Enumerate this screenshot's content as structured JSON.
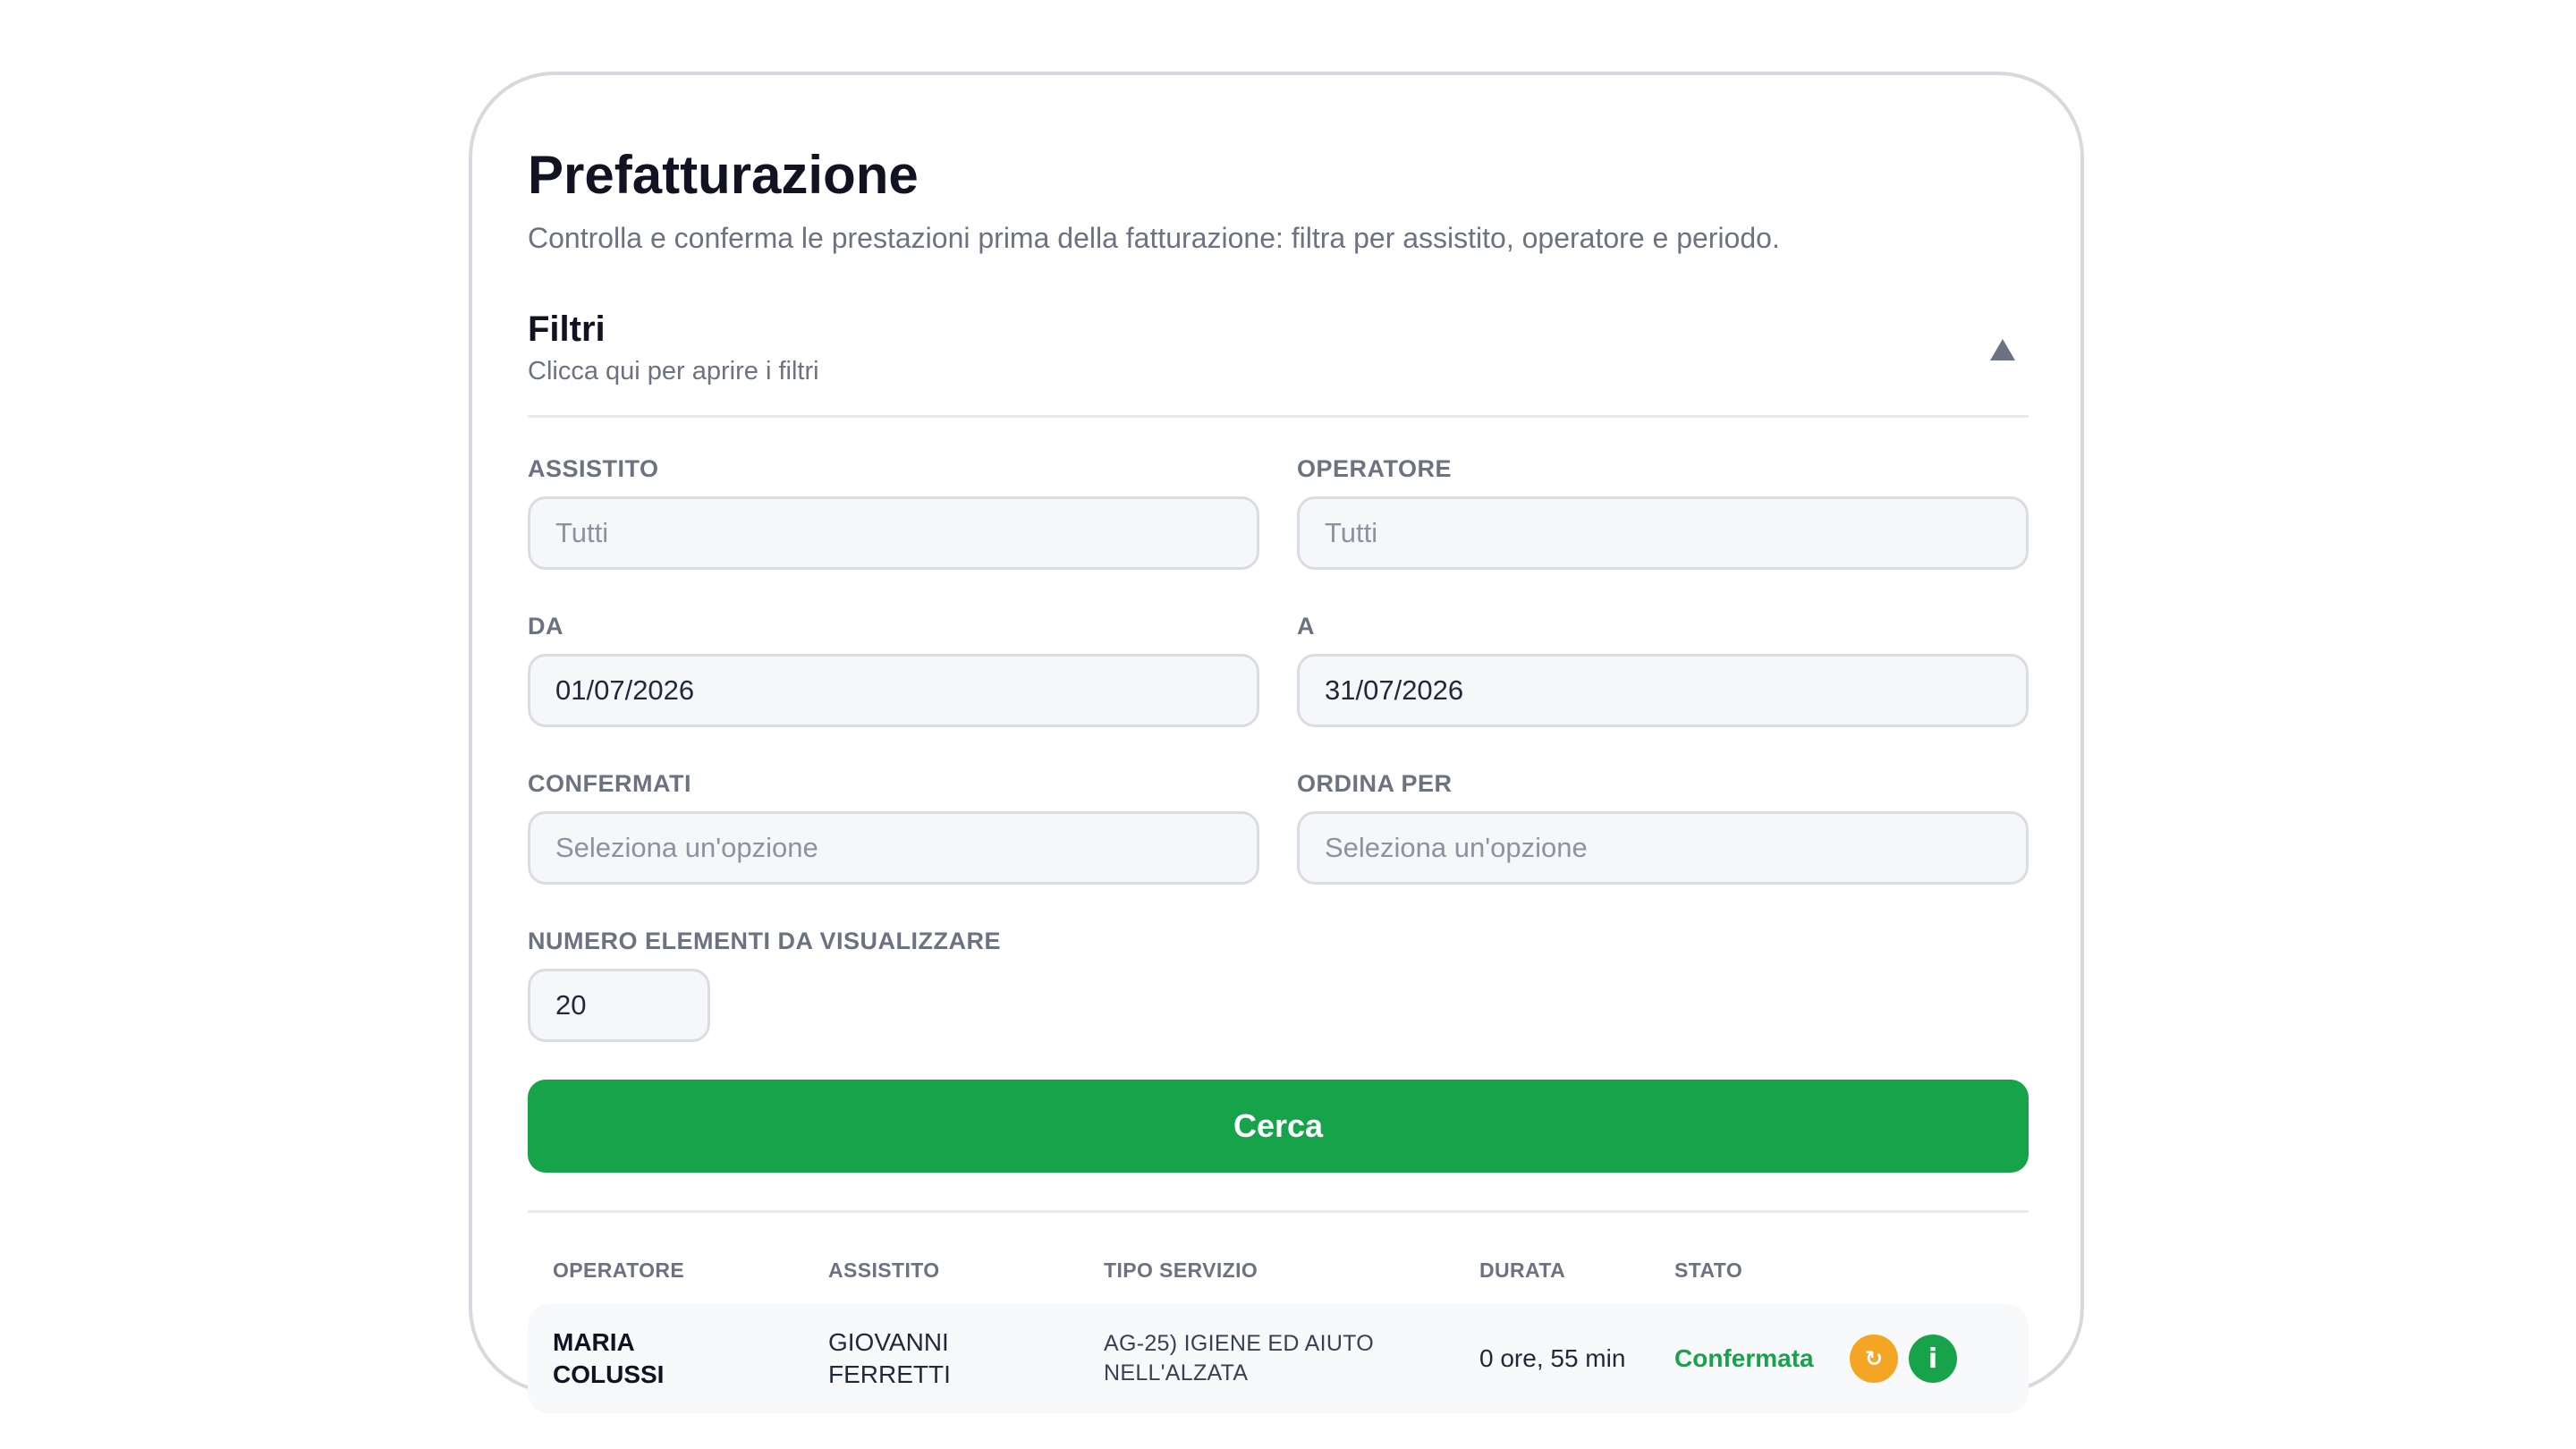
{
  "header": {
    "title": "Prefatturazione",
    "subtitle": "Controlla e conferma le prestazioni prima della fatturazione: filtra per assistito, operatore e periodo."
  },
  "filters": {
    "title": "Filtri",
    "hint": "Clicca qui per aprire i filtri",
    "toggle_icon": "triangle-up-icon",
    "assistito": {
      "label": "ASSISTITO",
      "placeholder": "Tutti"
    },
    "operatore": {
      "label": "OPERATORE",
      "placeholder": "Tutti"
    },
    "da": {
      "label": "DA",
      "value": "01/07/2026"
    },
    "a": {
      "label": "A",
      "value": "31/07/2026"
    },
    "confermati": {
      "label": "CONFERMATI",
      "placeholder": "Seleziona un'opzione"
    },
    "ordina_per": {
      "label": "ORDINA PER",
      "placeholder": "Seleziona un'opzione"
    },
    "numero_elementi": {
      "label": "NUMERO ELEMENTI DA VISUALIZZARE",
      "value": "20"
    },
    "search_label": "Cerca"
  },
  "table": {
    "columns": [
      "OPERATORE",
      "ASSISTITO",
      "TIPO SERVIZIO",
      "DURATA",
      "STATO"
    ],
    "rows": [
      {
        "operatore_line1": "MARIA",
        "operatore_line2": "COLUSSI",
        "assistito_line1": "GIOVANNI",
        "assistito_line2": "FERRETTI",
        "servizio_line1": "AG-25) IGIENE ED AIUTO",
        "servizio_line2": "NELL'ALZATA",
        "durata": "0 ore, 55 min",
        "stato": "Confermata",
        "reload_glyph": "↻",
        "info_glyph": "i"
      }
    ]
  },
  "colors": {
    "accent_green": "#16a34a",
    "action_orange": "#f5a524",
    "muted_text": "#6b7280",
    "border": "#d9dde3"
  }
}
